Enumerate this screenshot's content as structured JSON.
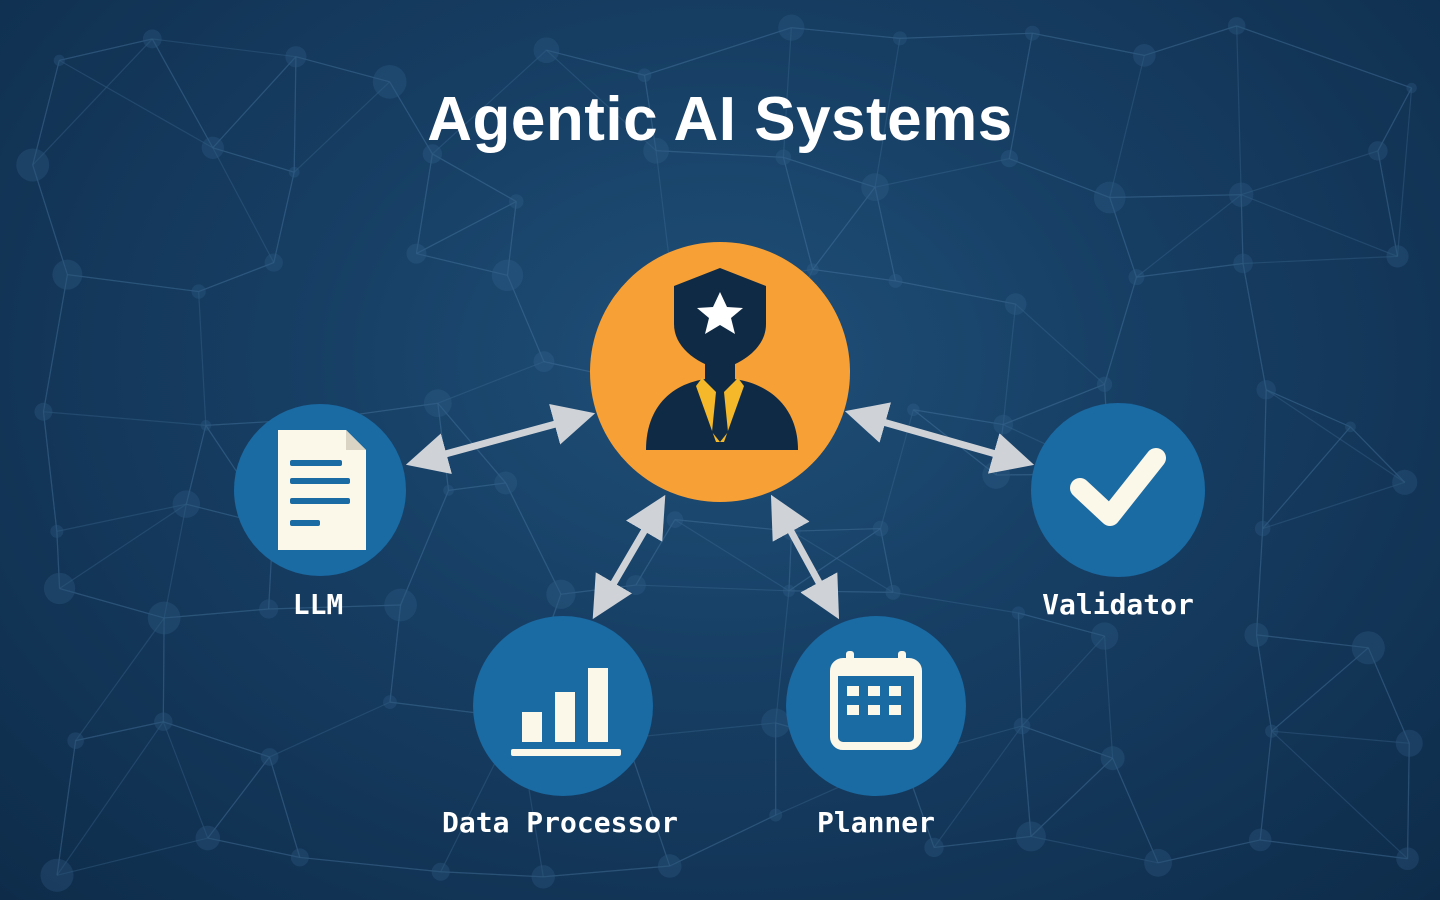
{
  "title": "Agentic AI Systems",
  "colors": {
    "hub": "#f7a035",
    "node": "#1a6aa3",
    "icon_dark": "#0f2a45",
    "icon_light": "#fbf7e9",
    "tie": "#f4b82a",
    "arrow": "#cfd3d8"
  },
  "hub": {
    "name": "agent",
    "icon": "agent-icon"
  },
  "nodes": [
    {
      "id": "llm",
      "label": "LLM",
      "icon": "document-icon"
    },
    {
      "id": "data-processor",
      "label": "Data Processor",
      "icon": "bar-chart-icon"
    },
    {
      "id": "planner",
      "label": "Planner",
      "icon": "calendar-icon"
    },
    {
      "id": "validator",
      "label": "Validator",
      "icon": "checkmark-icon"
    }
  ]
}
